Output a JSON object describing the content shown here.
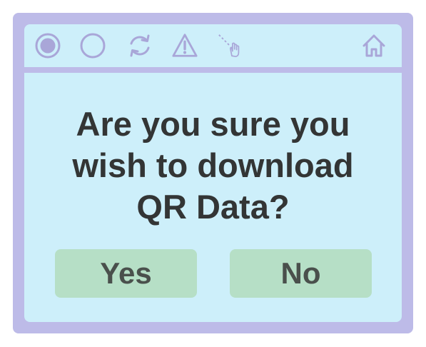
{
  "dialog": {
    "message_lines": [
      "Are you sure you",
      "wish to download",
      "QR Data?"
    ],
    "yes_label": "Yes",
    "no_label": "No"
  },
  "toolbar": {
    "icons": [
      "record-filled-icon",
      "record-empty-icon",
      "refresh-icon",
      "warning-icon",
      "pointer-hand-icon",
      "home-icon"
    ]
  },
  "colors": {
    "frame": "#bdbbe8",
    "panel": "#cdeffa",
    "icon": "#a9a6d8",
    "text": "#333535",
    "button": "#b6dfc6",
    "button_text": "#4a504c"
  }
}
